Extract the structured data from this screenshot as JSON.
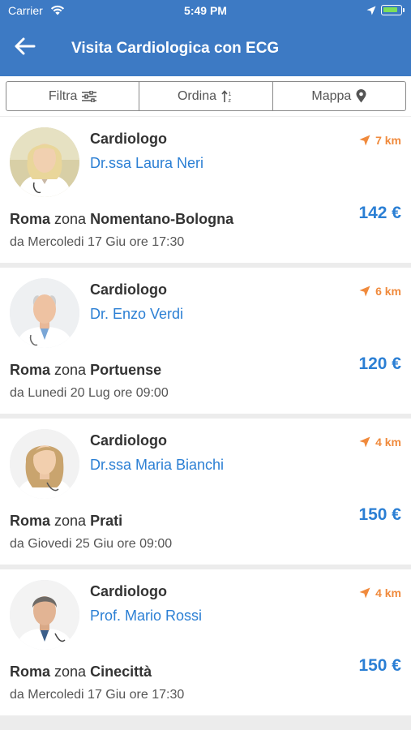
{
  "status_bar": {
    "carrier": "Carrier",
    "time": "5:49 PM"
  },
  "header": {
    "title": "Visita Cardiologica con ECG"
  },
  "toolbar": {
    "filter_label": "Filtra",
    "sort_label": "Ordina",
    "map_label": "Mappa"
  },
  "colors": {
    "primary": "#3d7ac4",
    "accent": "#2b7fd4",
    "distance": "#f08a3c"
  },
  "doctors": [
    {
      "specialty": "Cardiologo",
      "name": "Dr.ssa Laura Neri",
      "distance": "7 km",
      "city": "Roma",
      "zone_word": "zona",
      "zone": "Nomentano-Bologna",
      "availability": "da Mercoledi 17 Giu ore 17:30",
      "price": "142 €"
    },
    {
      "specialty": "Cardiologo",
      "name": "Dr. Enzo Verdi",
      "distance": "6 km",
      "city": "Roma",
      "zone_word": "zona",
      "zone": "Portuense",
      "availability": "da Lunedi 20 Lug ore 09:00",
      "price": "120 €"
    },
    {
      "specialty": "Cardiologo",
      "name": "Dr.ssa Maria Bianchi",
      "distance": "4 km",
      "city": "Roma",
      "zone_word": "zona",
      "zone": "Prati",
      "availability": "da Giovedi 25 Giu ore 09:00",
      "price": "150 €"
    },
    {
      "specialty": "Cardiologo",
      "name": "Prof. Mario Rossi",
      "distance": "4 km",
      "city": "Roma",
      "zone_word": "zona",
      "zone": "Cinecittà",
      "availability": "da Mercoledi 17 Giu ore 17:30",
      "price": "150 €"
    }
  ]
}
